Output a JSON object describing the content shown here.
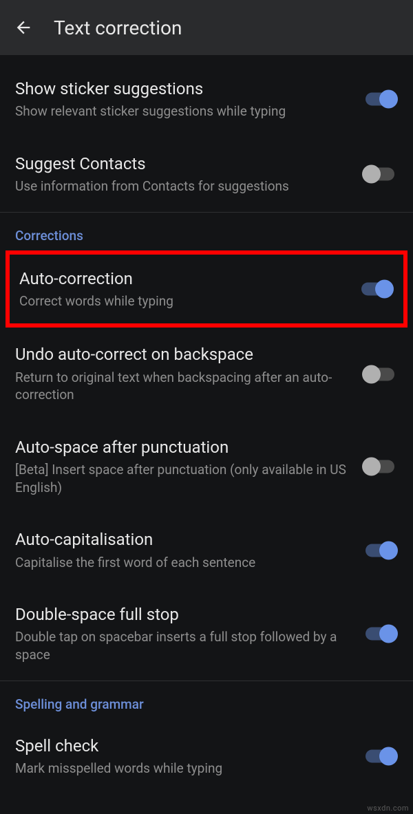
{
  "header": {
    "title": "Text correction"
  },
  "settings": {
    "sticker": {
      "title": "Show sticker suggestions",
      "subtitle": "Show relevant sticker suggestions while typing"
    },
    "contacts": {
      "title": "Suggest Contacts",
      "subtitle": "Use information from Contacts for suggestions"
    },
    "autocorrect": {
      "title": "Auto-correction",
      "subtitle": "Correct words while typing"
    },
    "undo": {
      "title": "Undo auto-correct on backspace",
      "subtitle": "Return to original text when backspacing after an auto-correction"
    },
    "autospace": {
      "title": "Auto-space after punctuation",
      "subtitle": "[Beta] Insert space after punctuation (only available in US English)"
    },
    "autocap": {
      "title": "Auto-capitalisation",
      "subtitle": "Capitalise the first word of each sentence"
    },
    "doublespace": {
      "title": "Double-space full stop",
      "subtitle": "Double tap on spacebar inserts a full stop followed by a space"
    },
    "spellcheck": {
      "title": "Spell check",
      "subtitle": "Mark misspelled words while typing"
    }
  },
  "sections": {
    "corrections": "Corrections",
    "spelling": "Spelling and grammar"
  },
  "watermark": "wsxdn.com"
}
